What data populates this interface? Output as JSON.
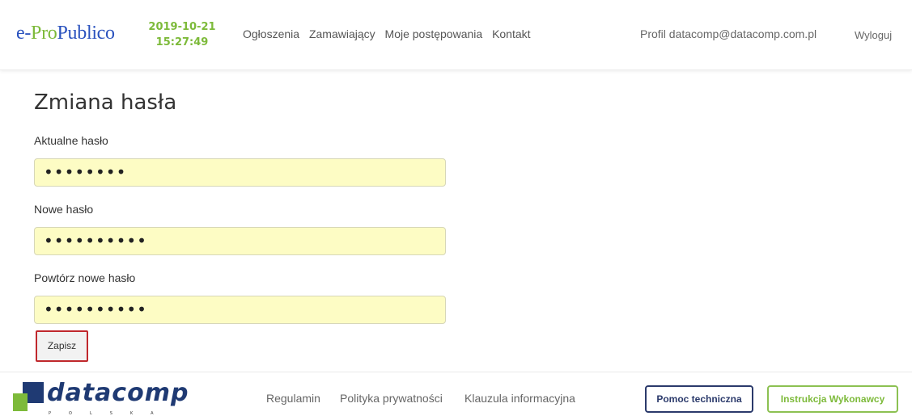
{
  "header": {
    "logo": {
      "part1": "e-",
      "part2": "Pro",
      "part3": "Publico"
    },
    "date": "2019-10-21",
    "time": "15:27:49",
    "nav": [
      "Ogłoszenia",
      "Zamawiający",
      "Moje postępowania",
      "Kontakt"
    ],
    "profile": "Profil datacomp@datacomp.com.pl",
    "logout": "Wyloguj"
  },
  "form": {
    "title": "Zmiana hasła",
    "current_label": "Aktualne hasło",
    "current_value": "••••••••",
    "new_label": "Nowe hasło",
    "new_value": "••••••••••",
    "repeat_label": "Powtórz nowe hasło",
    "repeat_value": "••••••••••",
    "save_label": "Zapisz"
  },
  "footer": {
    "brand": "datacomp",
    "brand_sub": "POLSKA",
    "links": [
      "Regulamin",
      "Polityka prywatności",
      "Klauzula informacyjna"
    ],
    "help_label": "Pomoc techniczna",
    "manual_label": "Instrukcja Wykonawcy"
  },
  "colors": {
    "brand_blue": "#2a52be",
    "brand_green": "#7dba3a",
    "input_fill": "#fdfcc4",
    "save_border": "#c0282d",
    "footer_navy": "#1f3a73"
  }
}
